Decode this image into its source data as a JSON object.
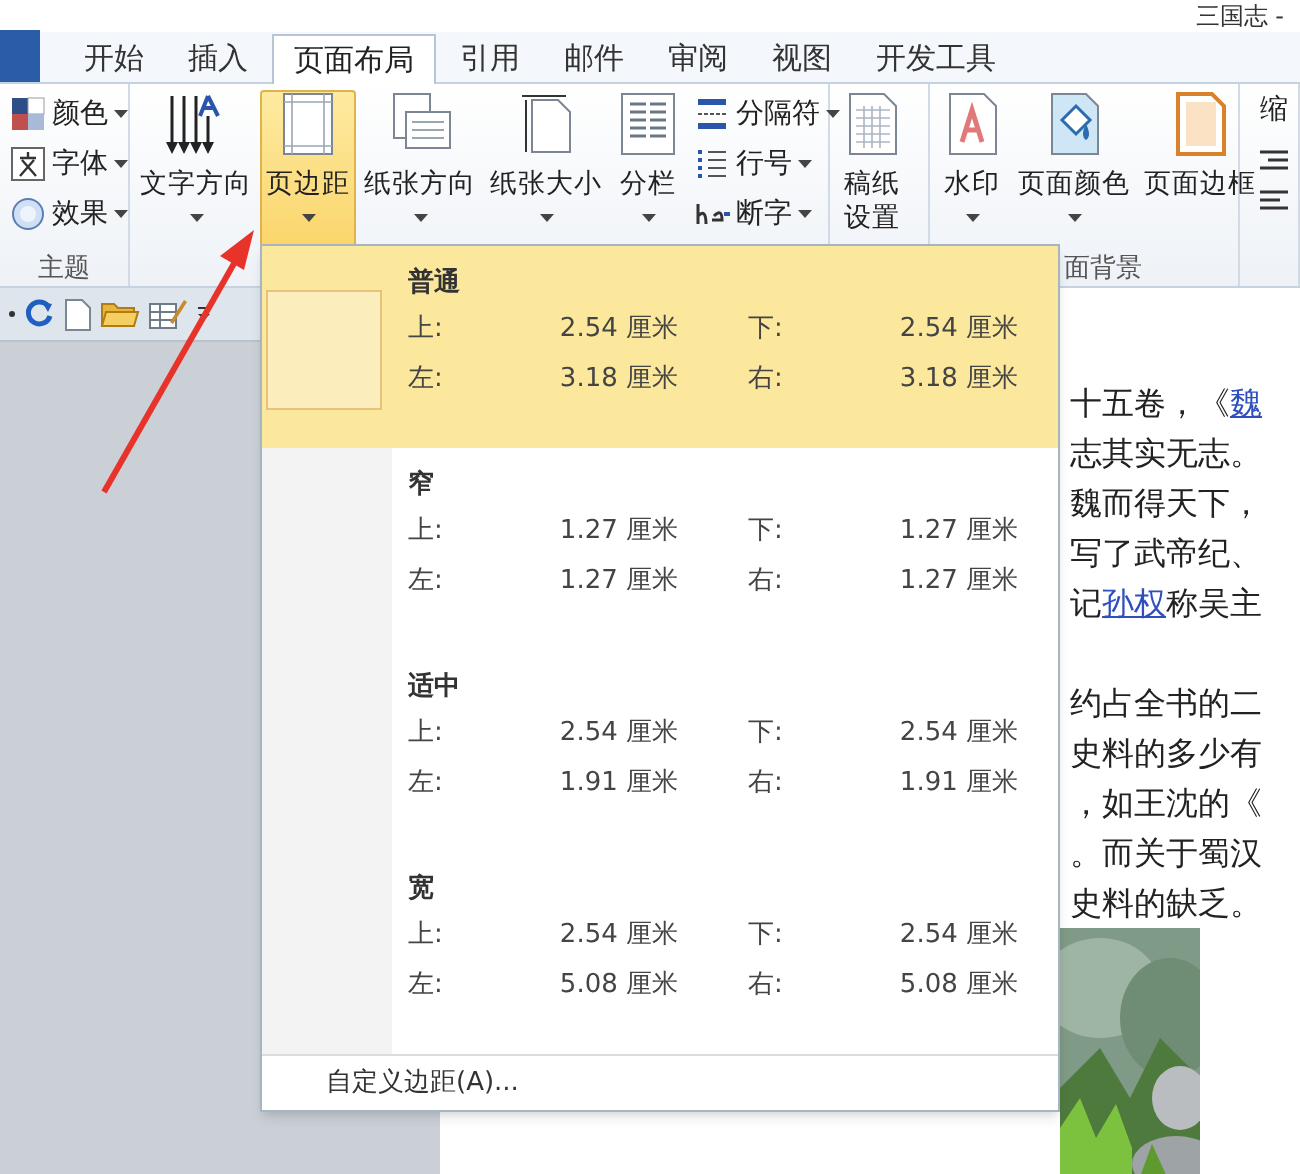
{
  "window": {
    "title": "三国志 -"
  },
  "tabs": [
    {
      "label": "开始",
      "selected": false
    },
    {
      "label": "插入",
      "selected": false
    },
    {
      "label": "页面布局",
      "selected": true
    },
    {
      "label": "引用",
      "selected": false
    },
    {
      "label": "邮件",
      "selected": false
    },
    {
      "label": "审阅",
      "selected": false
    },
    {
      "label": "视图",
      "selected": false
    },
    {
      "label": "开发工具",
      "selected": false
    }
  ],
  "ribbon": {
    "groups": [
      {
        "label": "主题",
        "buttons": [
          {
            "kind": "small",
            "label": "颜色",
            "active": false,
            "dropdown": true
          },
          {
            "kind": "small",
            "label": "字体",
            "active": false,
            "dropdown": true
          },
          {
            "kind": "small",
            "label": "效果",
            "active": false,
            "dropdown": true
          }
        ]
      },
      {
        "buttons": [
          {
            "kind": "large",
            "label": "文字方向",
            "active": false,
            "dropdown": true
          },
          {
            "kind": "large",
            "label": "页边距",
            "active": true,
            "dropdown": true
          },
          {
            "kind": "large",
            "label": "纸张方向",
            "active": false,
            "dropdown": true
          },
          {
            "kind": "large",
            "label": "纸张大小",
            "active": false,
            "dropdown": true
          },
          {
            "kind": "large",
            "label": "分栏",
            "active": false,
            "dropdown": true
          },
          {
            "kind": "small",
            "label": "分隔符",
            "active": false,
            "dropdown": true
          },
          {
            "kind": "small",
            "label": "行号",
            "active": false,
            "dropdown": true
          },
          {
            "kind": "small",
            "label": "断字",
            "active": false,
            "dropdown": true
          }
        ]
      },
      {
        "buttons": [
          {
            "kind": "large",
            "label": "稿纸设置",
            "active": false
          }
        ]
      },
      {
        "label": "面背景",
        "buttons": [
          {
            "kind": "large",
            "label": "水印",
            "active": false,
            "dropdown": true
          },
          {
            "kind": "large",
            "label": "页面颜色",
            "active": false,
            "dropdown": true
          },
          {
            "kind": "large",
            "label": "页面边框",
            "active": false
          }
        ]
      },
      {
        "buttons": [
          {
            "kind": "cut",
            "label": "缩"
          }
        ]
      }
    ]
  },
  "margins_menu": {
    "options": [
      {
        "name": "普通",
        "selected": true,
        "rows": [
          {
            "label": "上:",
            "value": "2.54 厘米"
          },
          {
            "label": "下:",
            "value": "2.54 厘米"
          },
          {
            "label": "左:",
            "value": "3.18 厘米"
          },
          {
            "label": "右:",
            "value": "3.18 厘米"
          }
        ]
      },
      {
        "name": "窄",
        "selected": false,
        "rows": [
          {
            "label": "上:",
            "value": "1.27 厘米"
          },
          {
            "label": "下:",
            "value": "1.27 厘米"
          },
          {
            "label": "左:",
            "value": "1.27 厘米"
          },
          {
            "label": "右:",
            "value": "1.27 厘米"
          }
        ]
      },
      {
        "name": "适中",
        "selected": false,
        "rows": [
          {
            "label": "上:",
            "value": "2.54 厘米"
          },
          {
            "label": "下:",
            "value": "2.54 厘米"
          },
          {
            "label": "左:",
            "value": "1.91 厘米"
          },
          {
            "label": "右:",
            "value": "1.91 厘米"
          }
        ]
      },
      {
        "name": "宽",
        "selected": false,
        "rows": [
          {
            "label": "上:",
            "value": "2.54 厘米"
          },
          {
            "label": "下:",
            "value": "2.54 厘米"
          },
          {
            "label": "左:",
            "value": "5.08 厘米"
          },
          {
            "label": "右:",
            "value": "5.08 厘米"
          }
        ]
      }
    ],
    "custom": "自定义边距(A)..."
  },
  "document": {
    "paragraphs": [
      [
        [
          {
            "text": "十五卷，《"
          },
          {
            "text": "魏",
            "link": true
          }
        ],
        [
          {
            "text": "志其实无志。"
          }
        ],
        [
          {
            "text": "魏而得天下，"
          }
        ],
        [
          {
            "text": "写了武帝纪、"
          }
        ],
        [
          {
            "text": "记"
          },
          {
            "text": "孙权",
            "link": true
          },
          {
            "text": "称吴主"
          }
        ]
      ],
      [
        [
          {
            "text": "约占全书的二"
          }
        ],
        [
          {
            "text": "史料的多少有"
          }
        ],
        [
          {
            "text": "，如王沈的《"
          }
        ],
        [
          {
            "text": "。而关于蜀汉"
          }
        ],
        [
          {
            "text": "史料的缺乏。"
          }
        ]
      ]
    ]
  }
}
